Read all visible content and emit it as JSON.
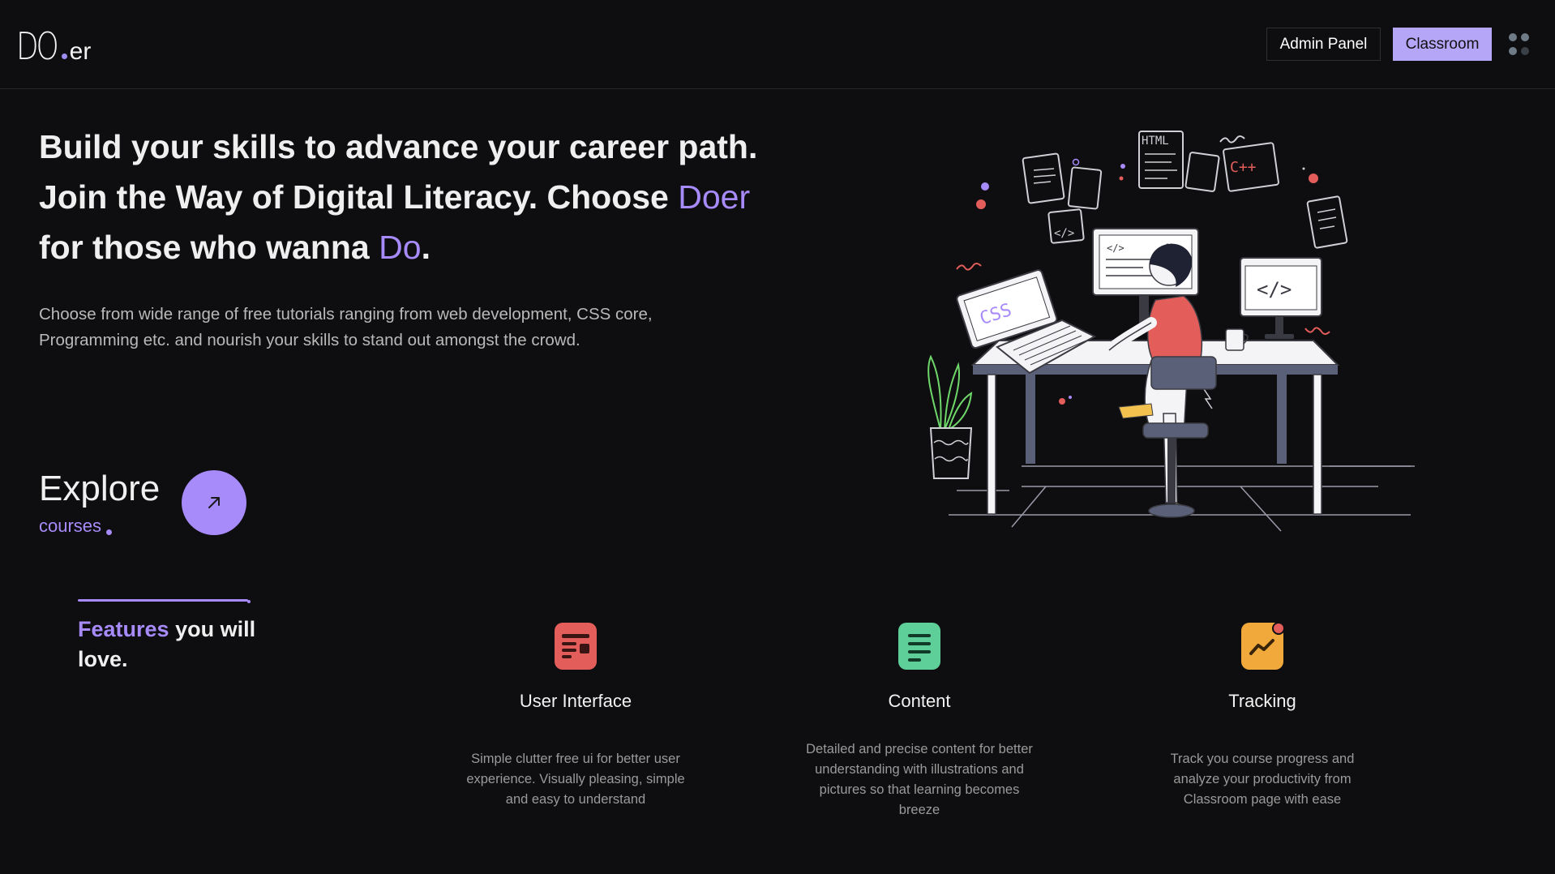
{
  "header": {
    "logo_mark": "DO",
    "logo_suffix": "er",
    "admin_label": "Admin Panel",
    "classroom_label": "Classroom",
    "menu_icon": "grid-dots-icon"
  },
  "hero": {
    "line1": "Build your skills to advance your career path.",
    "line2_pre": "Join the Way of Digital Literacy. Choose ",
    "line2_accent": "Doer",
    "line3_pre": "for those who wanna ",
    "line3_accent": "Do",
    "line3_post": ".",
    "subtitle": "Choose from wide range of free tutorials ranging from web development, CSS core, Programming etc. and nourish your skills to stand out amongst the crowd."
  },
  "explore": {
    "title": "Explore",
    "subtitle": "courses",
    "button_icon": "arrow-up-right-icon"
  },
  "features": {
    "title_accent": "Features",
    "title_rest": " you will love.",
    "items": [
      {
        "icon": "layout-icon",
        "name": "User Interface",
        "desc": "Simple clutter free ui for better user experience. Visually pleasing, simple and easy to understand"
      },
      {
        "icon": "document-icon",
        "name": "Content",
        "desc": "Detailed and precise content for better understanding with illustrations and pictures so that learning becomes breeze"
      },
      {
        "icon": "trend-chart-icon",
        "name": "Tracking",
        "desc": "Track you course progress and analyze your productivity from Classroom page with ease"
      }
    ]
  },
  "illustration": {
    "labels": [
      "HTML",
      "C++",
      "CSS",
      "</>"
    ]
  },
  "colors": {
    "accent": "#a78bfa",
    "classroom_bg": "#b6a6f7",
    "ui_icon": "#e35d5b",
    "content_icon": "#5fcf9a",
    "tracking_icon": "#f2a93b",
    "background": "#0e0e10"
  }
}
